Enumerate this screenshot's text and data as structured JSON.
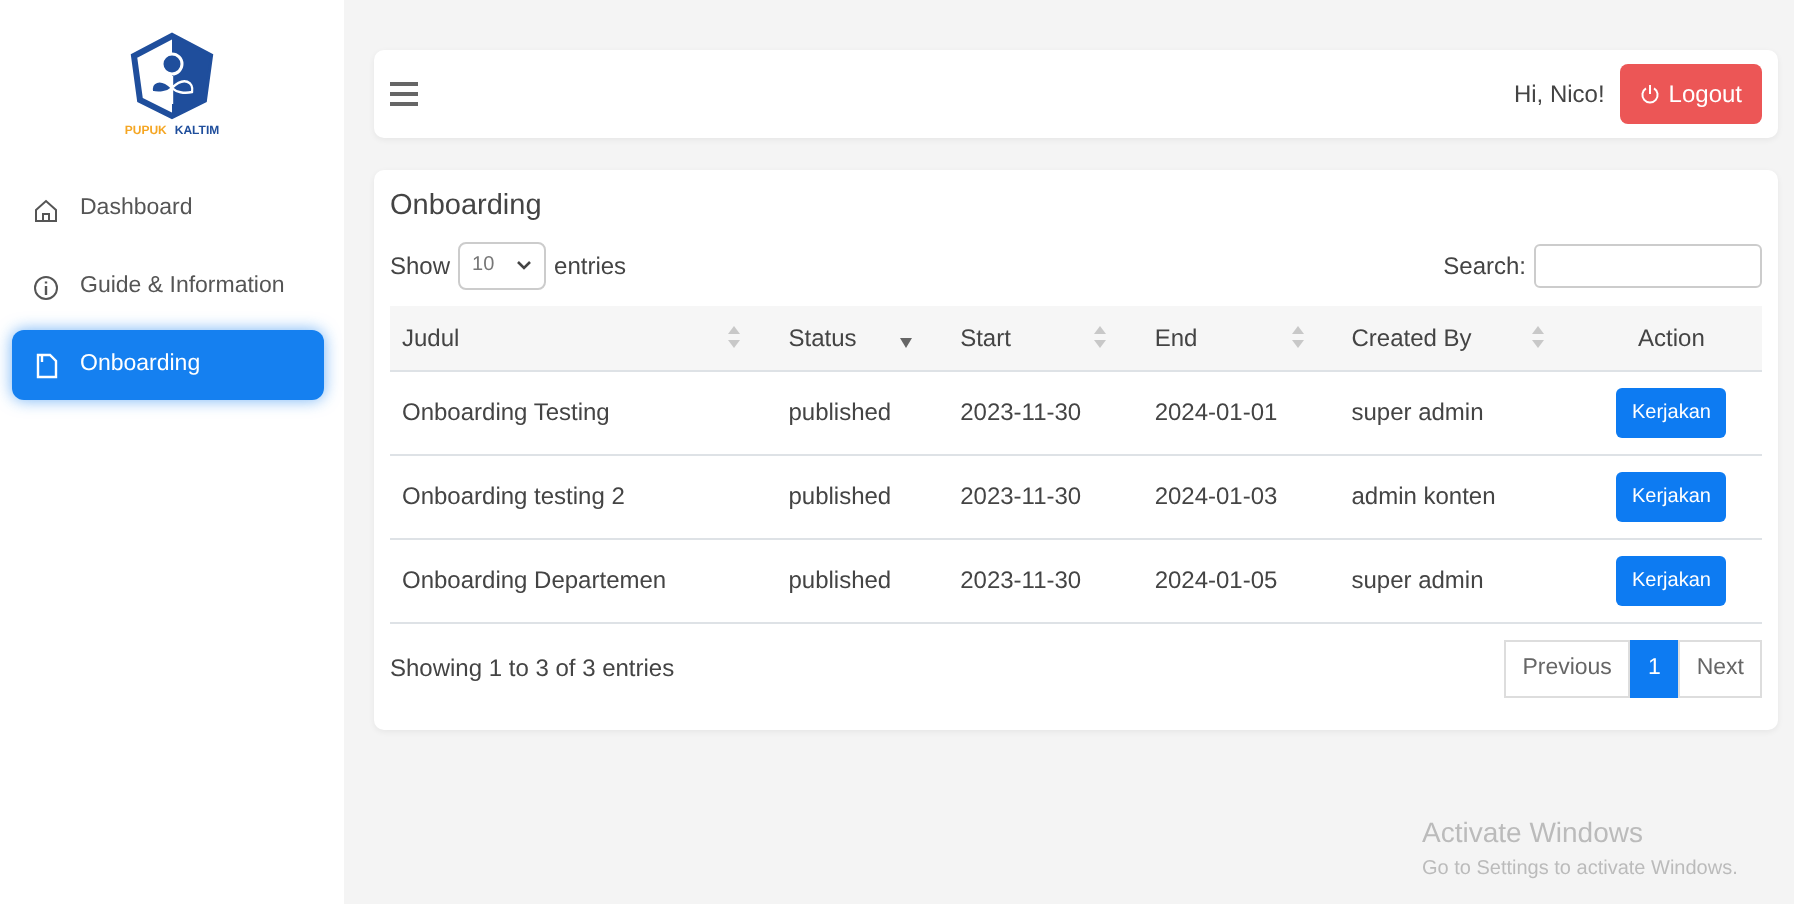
{
  "brand": {
    "words": [
      {
        "text": "PUPUK",
        "color": "#f5a623"
      },
      {
        "text": "KALTIM",
        "color": "#1f4e9c"
      }
    ]
  },
  "sidebar": {
    "items": [
      {
        "label": "Dashboard",
        "selected": false
      },
      {
        "label": "Guide & Information",
        "selected": false
      },
      {
        "label": "Onboarding",
        "selected": true
      }
    ]
  },
  "topbar": {
    "greeting": "Hi, Nico!",
    "logout": "Logout"
  },
  "card": {
    "title": "Onboarding",
    "show_label": "Show",
    "page_size": "10",
    "entries_label": "entries",
    "search_label": "Search:",
    "table": {
      "columns": [
        {
          "label": "Judul",
          "sortable": true,
          "sorted": false
        },
        {
          "label": "Status",
          "sortable": true,
          "sorted": true
        },
        {
          "label": "Start",
          "sortable": true,
          "sorted": false
        },
        {
          "label": "End",
          "sortable": true,
          "sorted": false
        },
        {
          "label": "Created By",
          "sortable": true,
          "sorted": false
        },
        {
          "label": "Action",
          "sortable": false
        }
      ],
      "rows": [
        {
          "cells": [
            "Onboarding Testing",
            "published",
            "2023-11-30",
            "2024-01-01",
            "super admin"
          ],
          "action": "Kerjakan"
        },
        {
          "cells": [
            "Onboarding testing 2",
            "published",
            "2023-11-30",
            "2024-01-03",
            "admin konten"
          ],
          "action": "Kerjakan"
        },
        {
          "cells": [
            "Onboarding Departemen",
            "published",
            "2023-11-30",
            "2024-01-05",
            "super admin"
          ],
          "action": "Kerjakan"
        }
      ]
    },
    "info": "Showing 1 to 3 of 3 entries",
    "pagination": [
      {
        "label": "Previous",
        "selected": false
      },
      {
        "label": "1",
        "selected": true
      },
      {
        "label": "Next",
        "selected": false
      }
    ]
  },
  "os_notice": {
    "title": "Activate Windows",
    "text": "Go to Settings to activate Windows."
  }
}
